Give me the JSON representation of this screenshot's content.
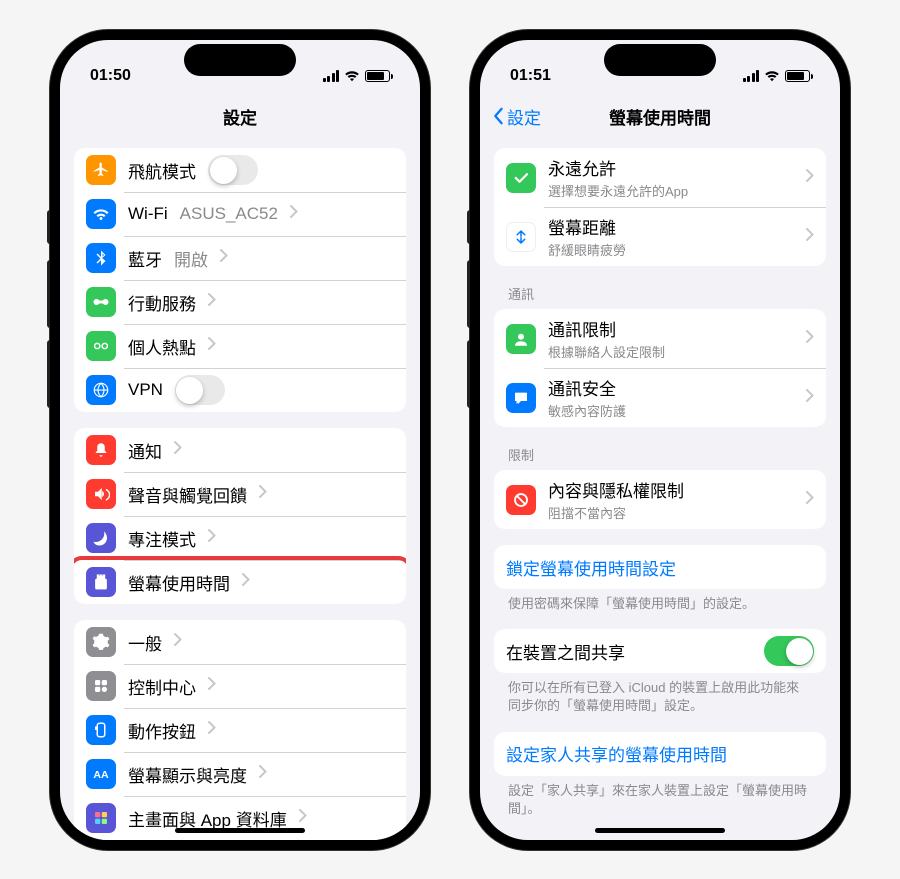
{
  "left": {
    "status_time": "01:50",
    "nav_title": "設定",
    "rows": {
      "airplane": "飛航模式",
      "wifi": "Wi-Fi",
      "wifi_val": "ASUS_AC52",
      "bluetooth": "藍牙",
      "bluetooth_val": "開啟",
      "cellular": "行動服務",
      "hotspot": "個人熱點",
      "vpn": "VPN",
      "notifications": "通知",
      "sound": "聲音與觸覺回饋",
      "focus": "專注模式",
      "screentime": "螢幕使用時間",
      "general": "一般",
      "control": "控制中心",
      "action": "動作按鈕",
      "display": "螢幕顯示與亮度",
      "home": "主畫面與 App 資料庫"
    }
  },
  "right": {
    "status_time": "01:51",
    "back": "設定",
    "nav_title": "螢幕使用時間",
    "rows": {
      "always_allow": "永遠允許",
      "always_allow_sub": "選擇想要永遠允許的App",
      "distance": "螢幕距離",
      "distance_sub": "舒緩眼睛疲勞",
      "comm_limits": "通訊限制",
      "comm_limits_sub": "根據聯絡人設定限制",
      "comm_safety": "通訊安全",
      "comm_safety_sub": "敏感內容防護",
      "content_privacy": "內容與隱私權限制",
      "content_privacy_sub": "阻擋不當內容",
      "lock_settings": "鎖定螢幕使用時間設定",
      "share_devices": "在裝置之間共享",
      "family_share": "設定家人共享的螢幕使用時間"
    },
    "headers": {
      "comm": "通訊",
      "restrict": "限制"
    },
    "footers": {
      "lock": "使用密碼來保障「螢幕使用時間」的設定。",
      "share": "你可以在所有已登入 iCloud 的裝置上啟用此功能來同步你的「螢幕使用時間」設定。",
      "family": "設定「家人共享」來在家人裝置上設定「螢幕使用時間」。"
    }
  }
}
